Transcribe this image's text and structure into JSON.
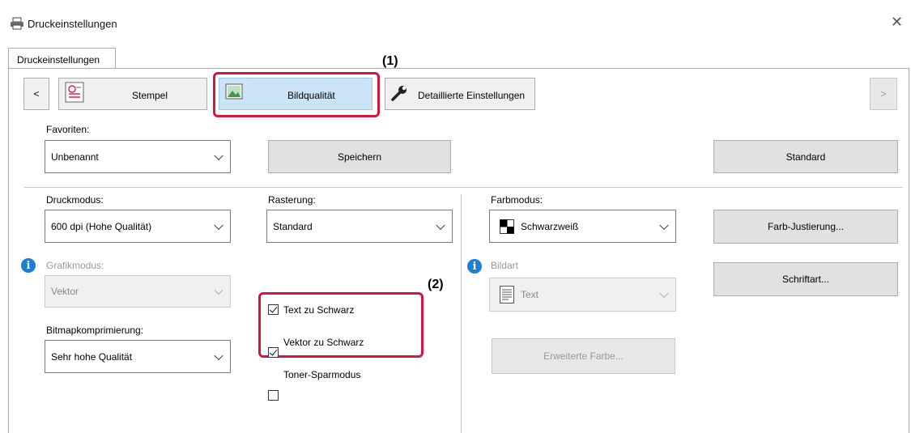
{
  "window": {
    "title": "Druckeinstellungen"
  },
  "tab": {
    "label": "Druckeinstellungen"
  },
  "toolbar": {
    "prev": "<",
    "next": ">",
    "stempel": "Stempel",
    "bildqualitaet": "Bildqualität",
    "detail": "Detaillierte Einstellungen"
  },
  "callouts": {
    "one": "(1)",
    "two": "(2)"
  },
  "favoriten": {
    "label": "Favoriten:",
    "value": "Unbenannt",
    "save": "Speichern",
    "standard": "Standard"
  },
  "druckmodus": {
    "label": "Druckmodus:",
    "value": "600 dpi (Hohe Qualität)"
  },
  "grafikmodus": {
    "label": "Grafikmodus:",
    "value": "Vektor"
  },
  "bitmap": {
    "label": "Bitmapkomprimierung:",
    "value": "Sehr hohe Qualität"
  },
  "rasterung": {
    "label": "Rasterung:",
    "value": "Standard"
  },
  "checks": {
    "text_schwarz": {
      "label": "Text zu Schwarz",
      "checked": true
    },
    "vektor_schwarz": {
      "label": "Vektor zu Schwarz",
      "checked": true
    },
    "toner": {
      "label": "Toner-Sparmodus",
      "checked": false
    }
  },
  "farbmodus": {
    "label": "Farbmodus:",
    "value": "Schwarzweiß"
  },
  "bildart": {
    "label": "Bildart",
    "value": "Text"
  },
  "buttons": {
    "farb_justierung": "Farb-Justierung...",
    "schriftart": "Schriftart...",
    "erweiterte": "Erweiterte Farbe..."
  },
  "colors": {
    "accent_red": "#d6163c",
    "info_blue": "#1b7fd4",
    "selected_tab": "#cce4f7"
  }
}
